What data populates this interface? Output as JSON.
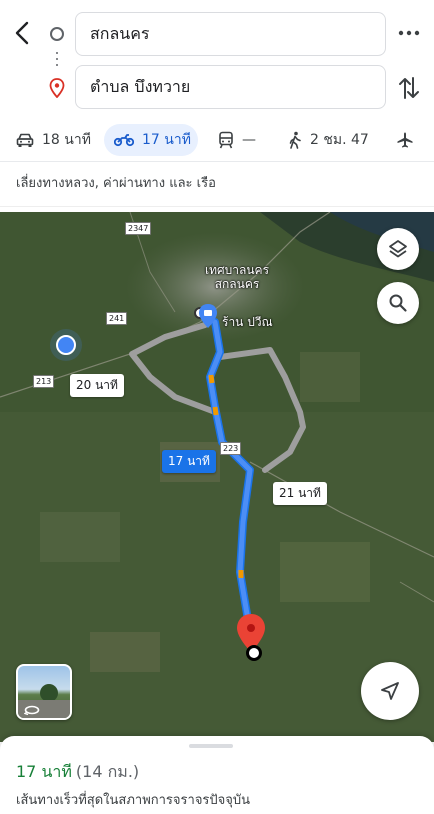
{
  "header": {
    "origin": "สกลนคร",
    "destination": "ตำบล บึงทวาย"
  },
  "modes": {
    "car": "18 นาที",
    "motorcycle": "17 นาที",
    "transit": "—",
    "walk": "2 ชม. 47",
    "selected": "motorcycle"
  },
  "route_note": "เลี่ยงทางหลวง, ค่าผ่านทาง และ เรือ",
  "map": {
    "town_line1": "เทศบาลนคร",
    "town_line2": "สกลนคร",
    "shop": "ร้าน ปวีณ",
    "roads": [
      "2347",
      "241",
      "213",
      "223"
    ],
    "routes": [
      {
        "label": "17 นาที",
        "selected": true
      },
      {
        "label": "20 นาที",
        "selected": false
      },
      {
        "label": "21 นาที",
        "selected": false
      }
    ],
    "colors": {
      "selected_route": "#4285f4",
      "alt_route": "#a9a9a9",
      "pin": "#ea4335"
    }
  },
  "sheet": {
    "duration": "17 นาที",
    "distance": "(14 กม.)",
    "description": "เส้นทางเร็วที่สุดในสภาพการจราจรปัจจุบัน"
  }
}
